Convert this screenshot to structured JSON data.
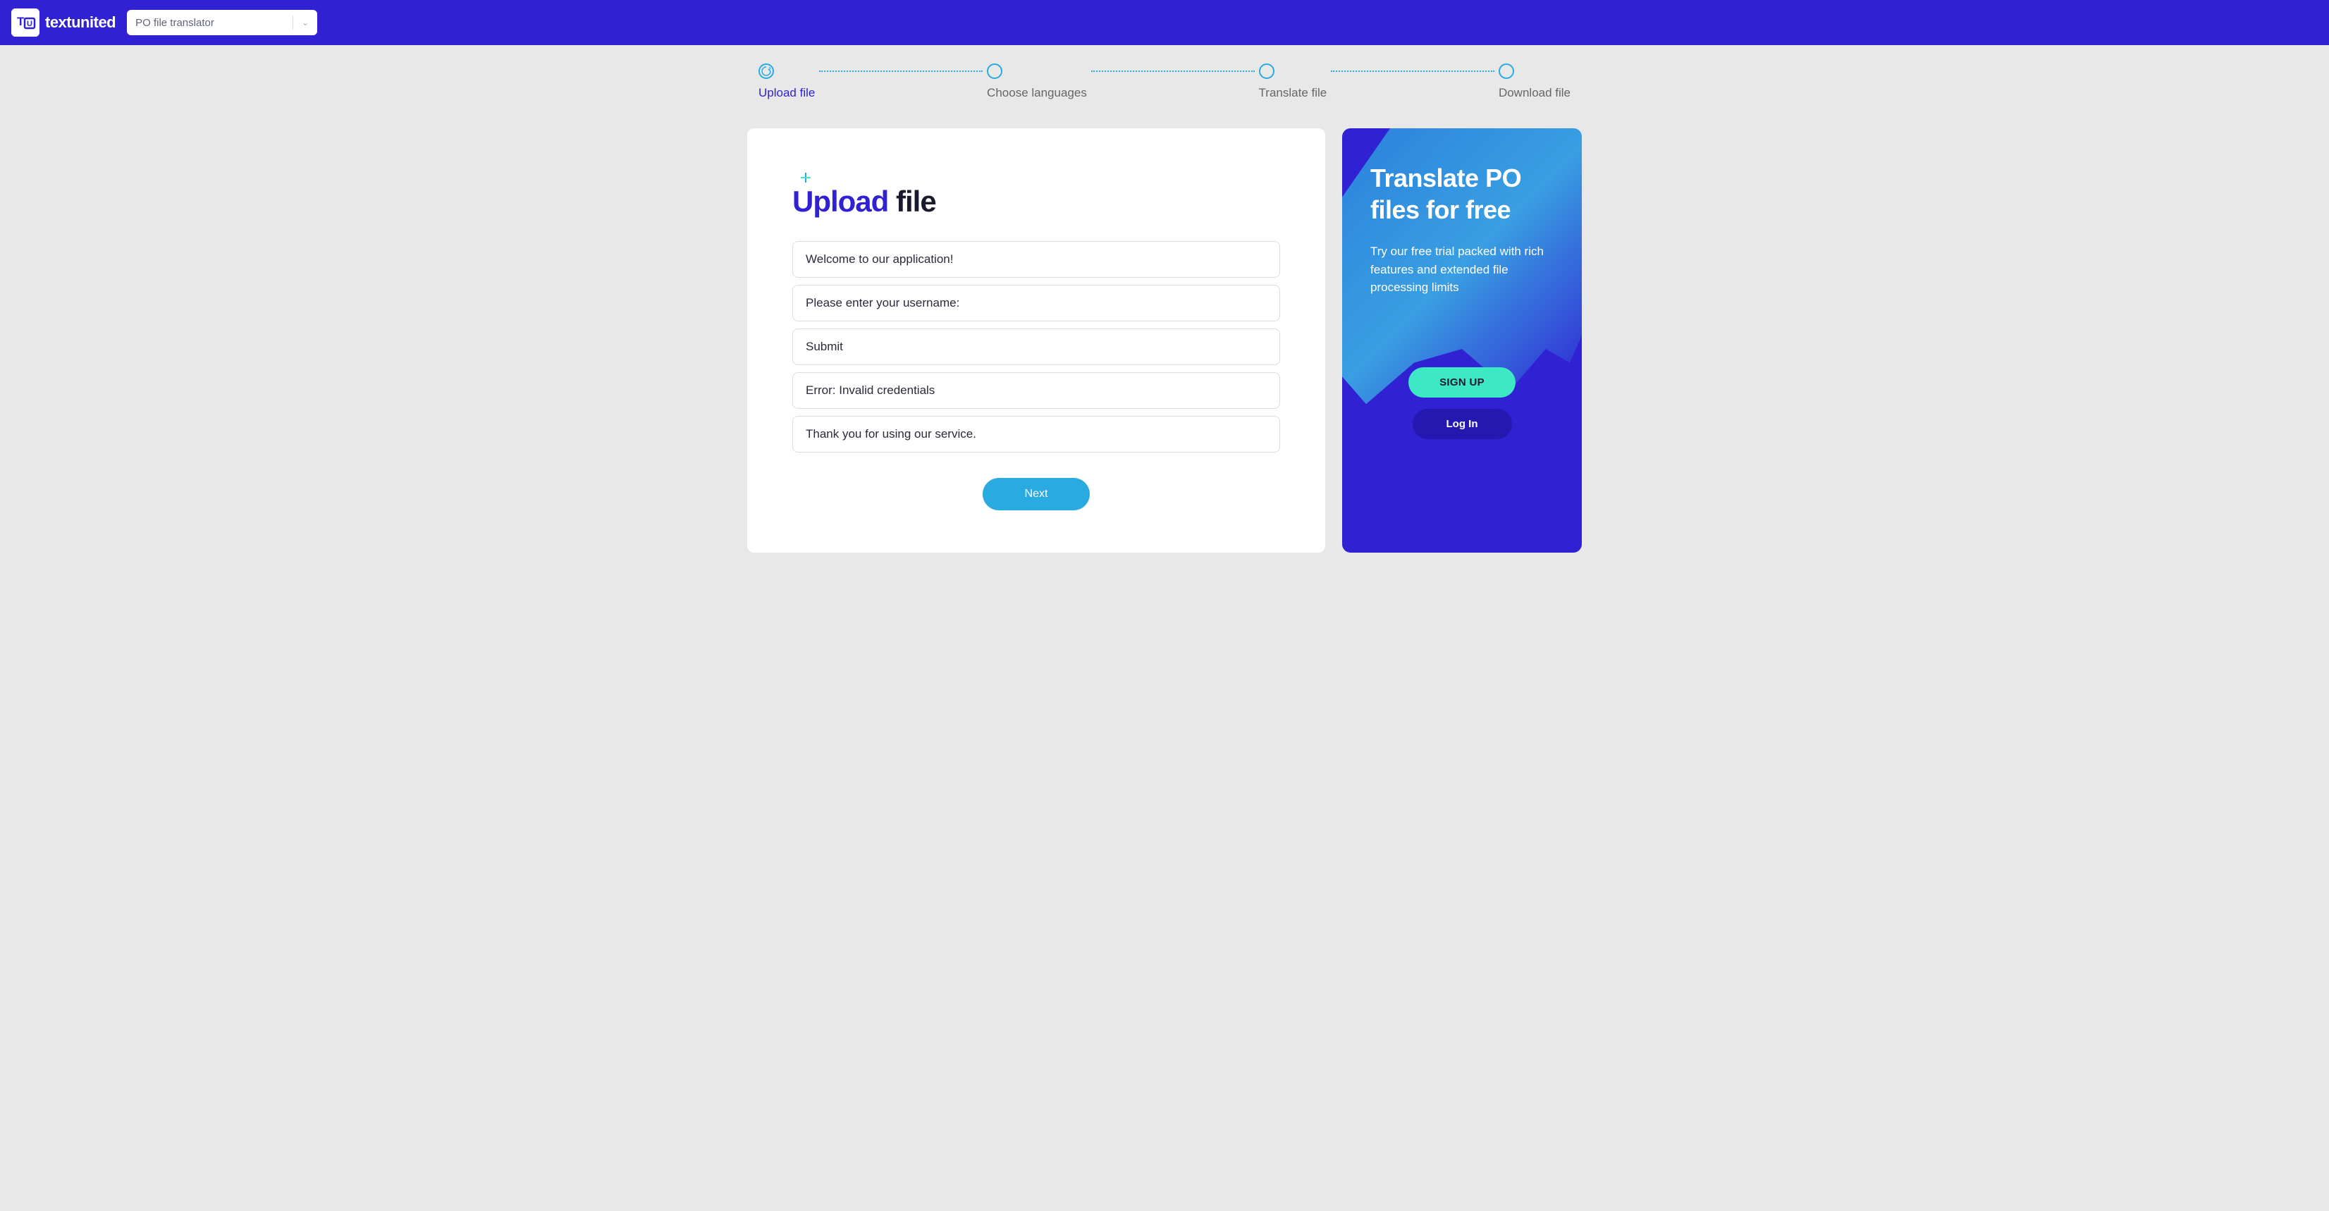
{
  "header": {
    "brand": "textunited",
    "dropdown_label": "PO file translator"
  },
  "stepper": {
    "steps": [
      {
        "label": "Upload file",
        "active": true
      },
      {
        "label": "Choose languages",
        "active": false
      },
      {
        "label": "Translate file",
        "active": false
      },
      {
        "label": "Download file",
        "active": false
      }
    ]
  },
  "upload": {
    "title_accent": "Upload",
    "title_rest": " file",
    "rows": [
      "Welcome to our application!",
      "Please enter your username:",
      "Submit",
      "Error: Invalid credentials",
      "Thank you for using our service."
    ],
    "next_label": "Next"
  },
  "sidebar": {
    "title": "Translate PO files for free",
    "description": "Try our free trial packed with rich features and extended file processing limits",
    "signup_label": "SIGN UP",
    "login_label": "Log In"
  }
}
